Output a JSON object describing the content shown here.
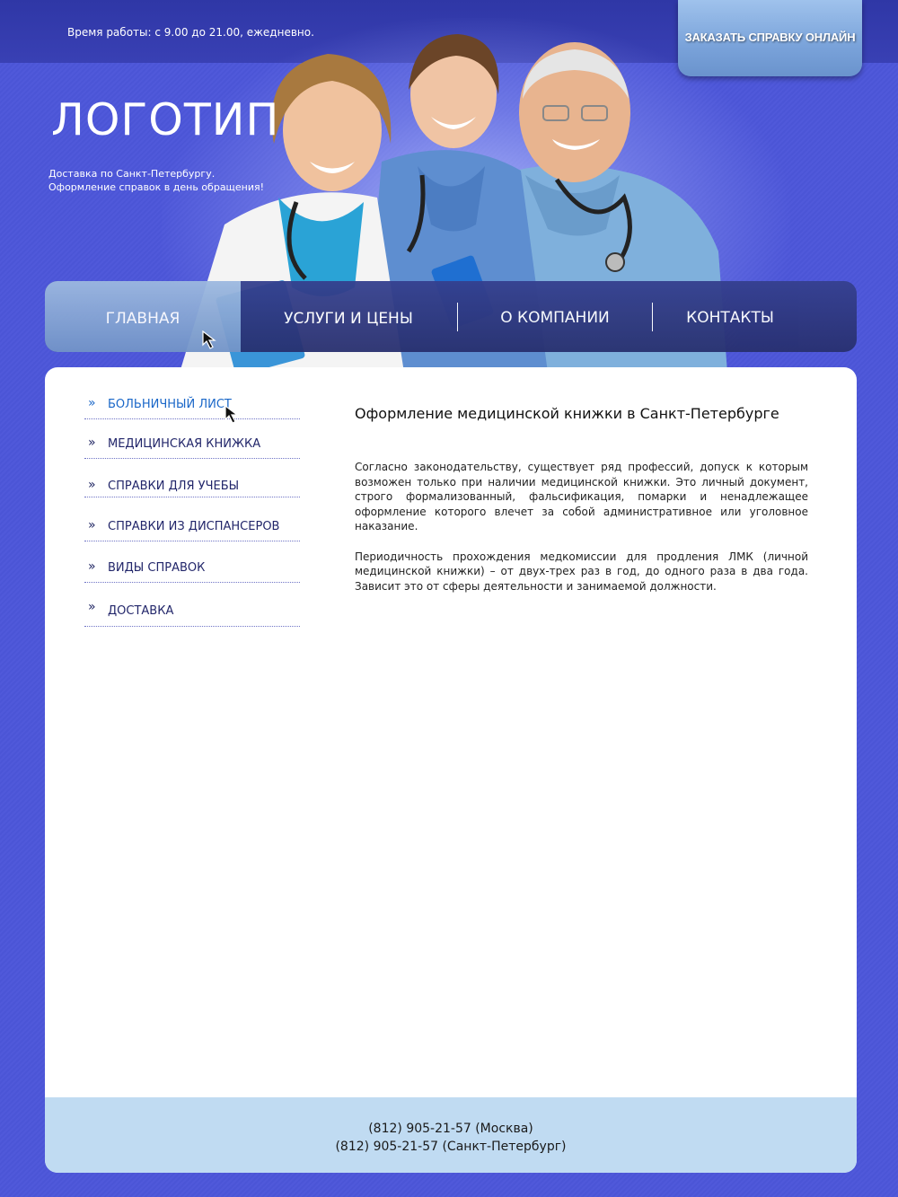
{
  "header": {
    "hours": "Время работы: с 9.00 до 21.00, ежедневно.",
    "order_button": "ЗАКАЗАТЬ СПРАВКУ ОНЛАЙН",
    "logo": "ЛОГОТИП",
    "tagline_line1": "Доставка по Санкт-Петербургу.",
    "tagline_line2": "Оформление справок в день обращения!"
  },
  "nav": {
    "items": [
      {
        "label": "ГЛАВНАЯ",
        "active": true
      },
      {
        "label": "УСЛУГИ И ЦЕНЫ",
        "active": false
      },
      {
        "label": "О КОМПАНИИ",
        "active": false
      },
      {
        "label": "КОНТАКТЫ",
        "active": false
      }
    ]
  },
  "sidebar": {
    "bullet": "»",
    "items": [
      {
        "label": "БОЛЬНИЧНЫЙ ЛИСТ",
        "active": true
      },
      {
        "label": "МЕДИЦИНСКАЯ КНИЖКА",
        "active": false
      },
      {
        "label": "СПРАВКИ ДЛЯ УЧЕБЫ",
        "active": false
      },
      {
        "label": "СПРАВКИ ИЗ ДИСПАНСЕРОВ",
        "active": false
      },
      {
        "label": "ВИДЫ СПРАВОК",
        "active": false
      },
      {
        "label": "ДОСТАВКА",
        "active": false
      }
    ]
  },
  "article": {
    "title": "Оформление медицинской книжки в Санкт-Петербурге",
    "paragraph1": "Согласно законодательству, существует ряд профессий, допуск к которым возможен только при наличии медицинской книжки. Это личный документ, строго формализованный, фальсификация, помарки и ненадлежащее оформление которого влечет за собой административное или уголовное наказание.",
    "paragraph2": "Периодичность прохождения медкомиссии для продления ЛМК (личной медицинской книжки) – от двух-трех раз в год, до одного раза в два года. Зависит это от сферы деятельности и занимаемой должности."
  },
  "footer": {
    "phone_moscow": "(812) 905-21-57 (Москва)",
    "phone_spb": "(812) 905-21-57 (Санкт-Петербург)"
  },
  "colors": {
    "background": "#4b55d6",
    "topbar": "#3239ab",
    "nav_dark": "#2b336f",
    "nav_active": "#8aa8d6",
    "sidebar_active": "#1a67c8",
    "footer": "#c0dbf2"
  }
}
